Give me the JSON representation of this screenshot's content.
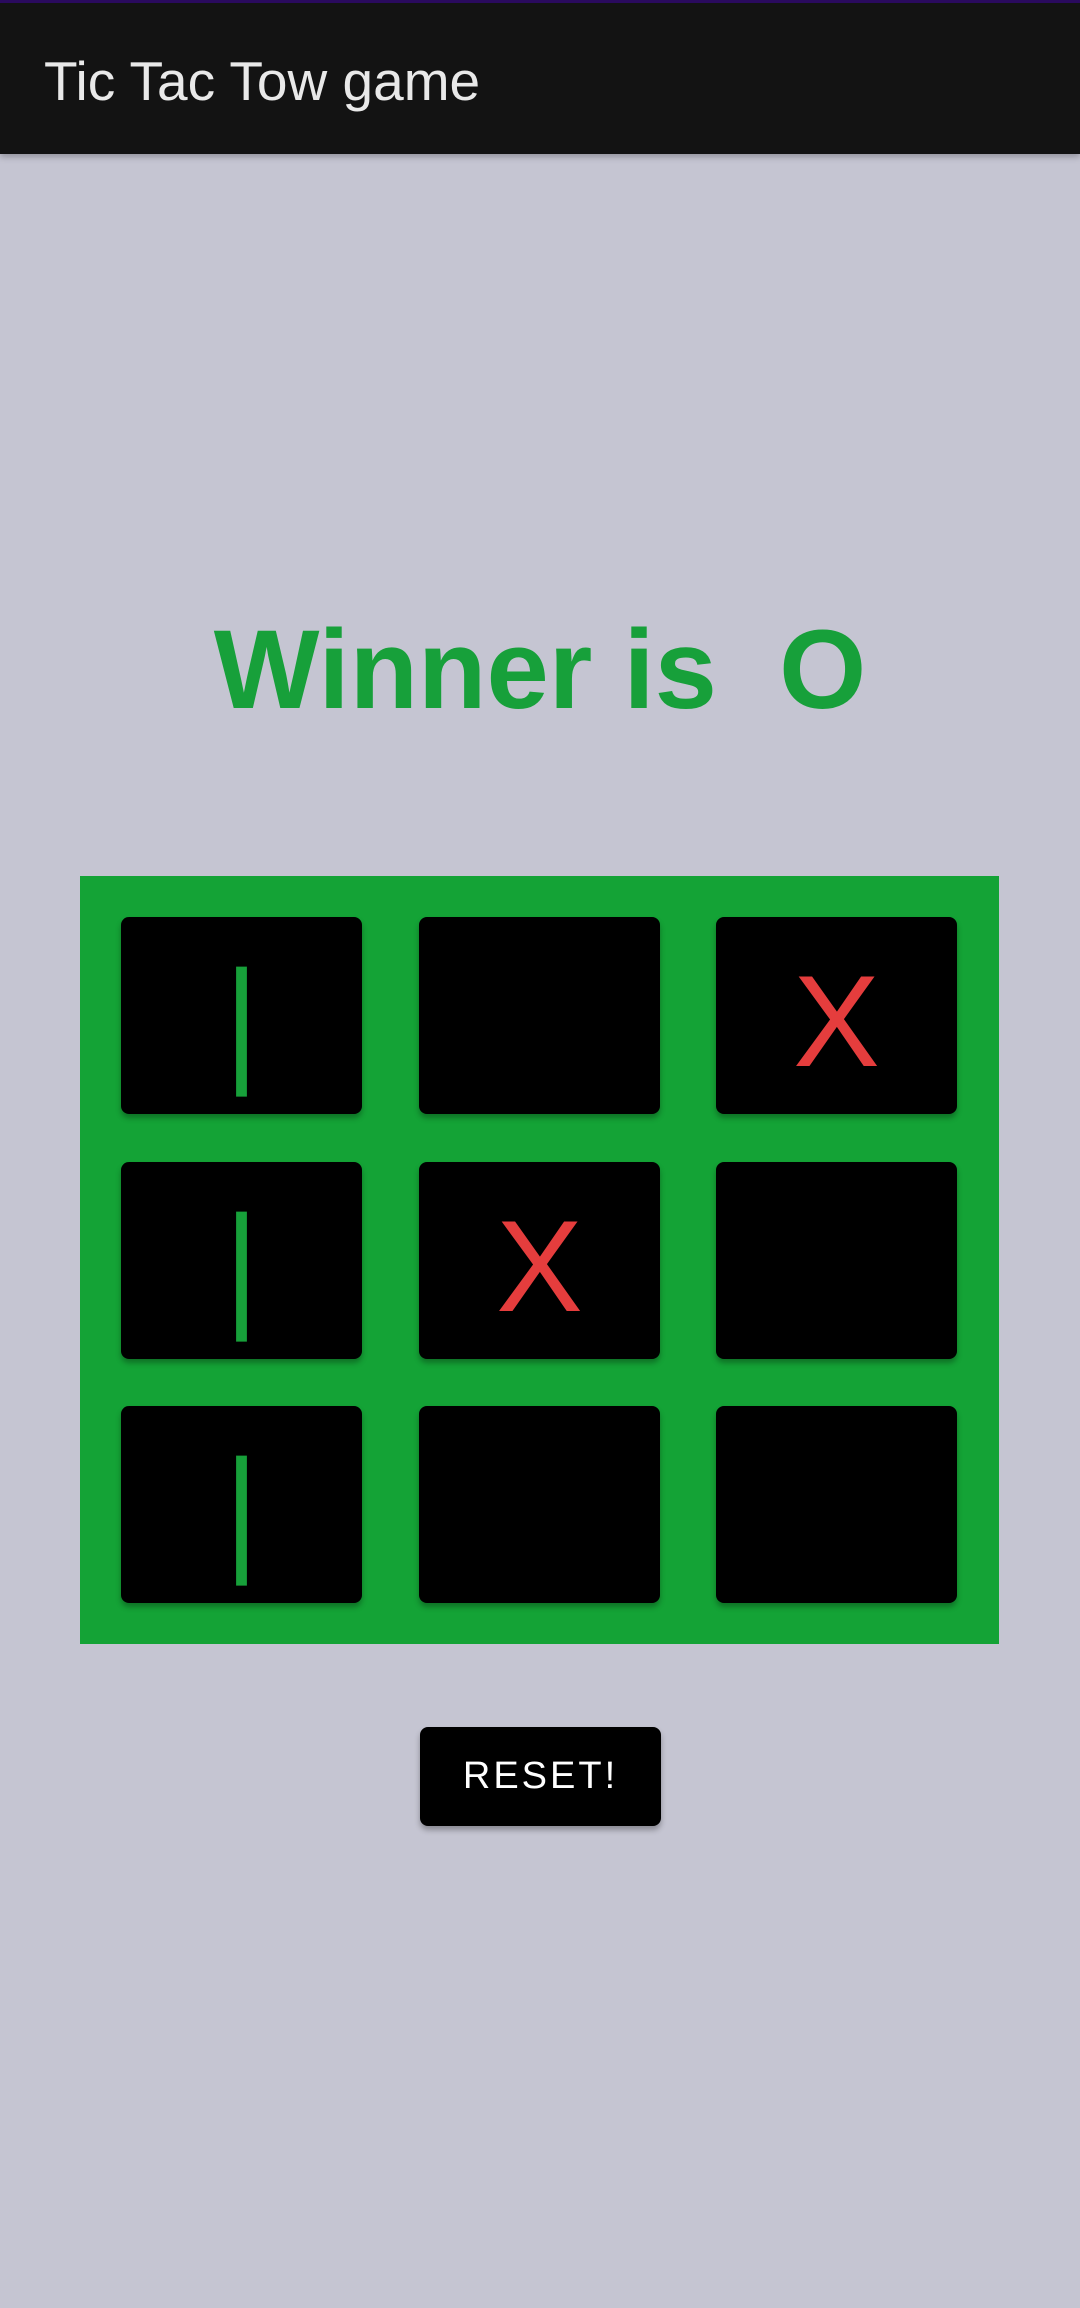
{
  "app_bar": {
    "title": "Tic Tac Tow game"
  },
  "status": {
    "text": "Winner is  O"
  },
  "board": {
    "cells": [
      {
        "mark": "|",
        "player": "O"
      },
      {
        "mark": "",
        "player": ""
      },
      {
        "mark": "X",
        "player": "X"
      },
      {
        "mark": "|",
        "player": "O"
      },
      {
        "mark": "X",
        "player": "X"
      },
      {
        "mark": "",
        "player": ""
      },
      {
        "mark": "|",
        "player": "O"
      },
      {
        "mark": "",
        "player": ""
      },
      {
        "mark": "",
        "player": ""
      }
    ]
  },
  "actions": {
    "reset_label": "RESET!"
  },
  "colors": {
    "background": "#c5c5d2",
    "app_bar": "#131313",
    "board": "#14a336",
    "winner_text": "#17a03a",
    "x_mark": "#e53d3d",
    "o_mark": "#17a03a"
  }
}
